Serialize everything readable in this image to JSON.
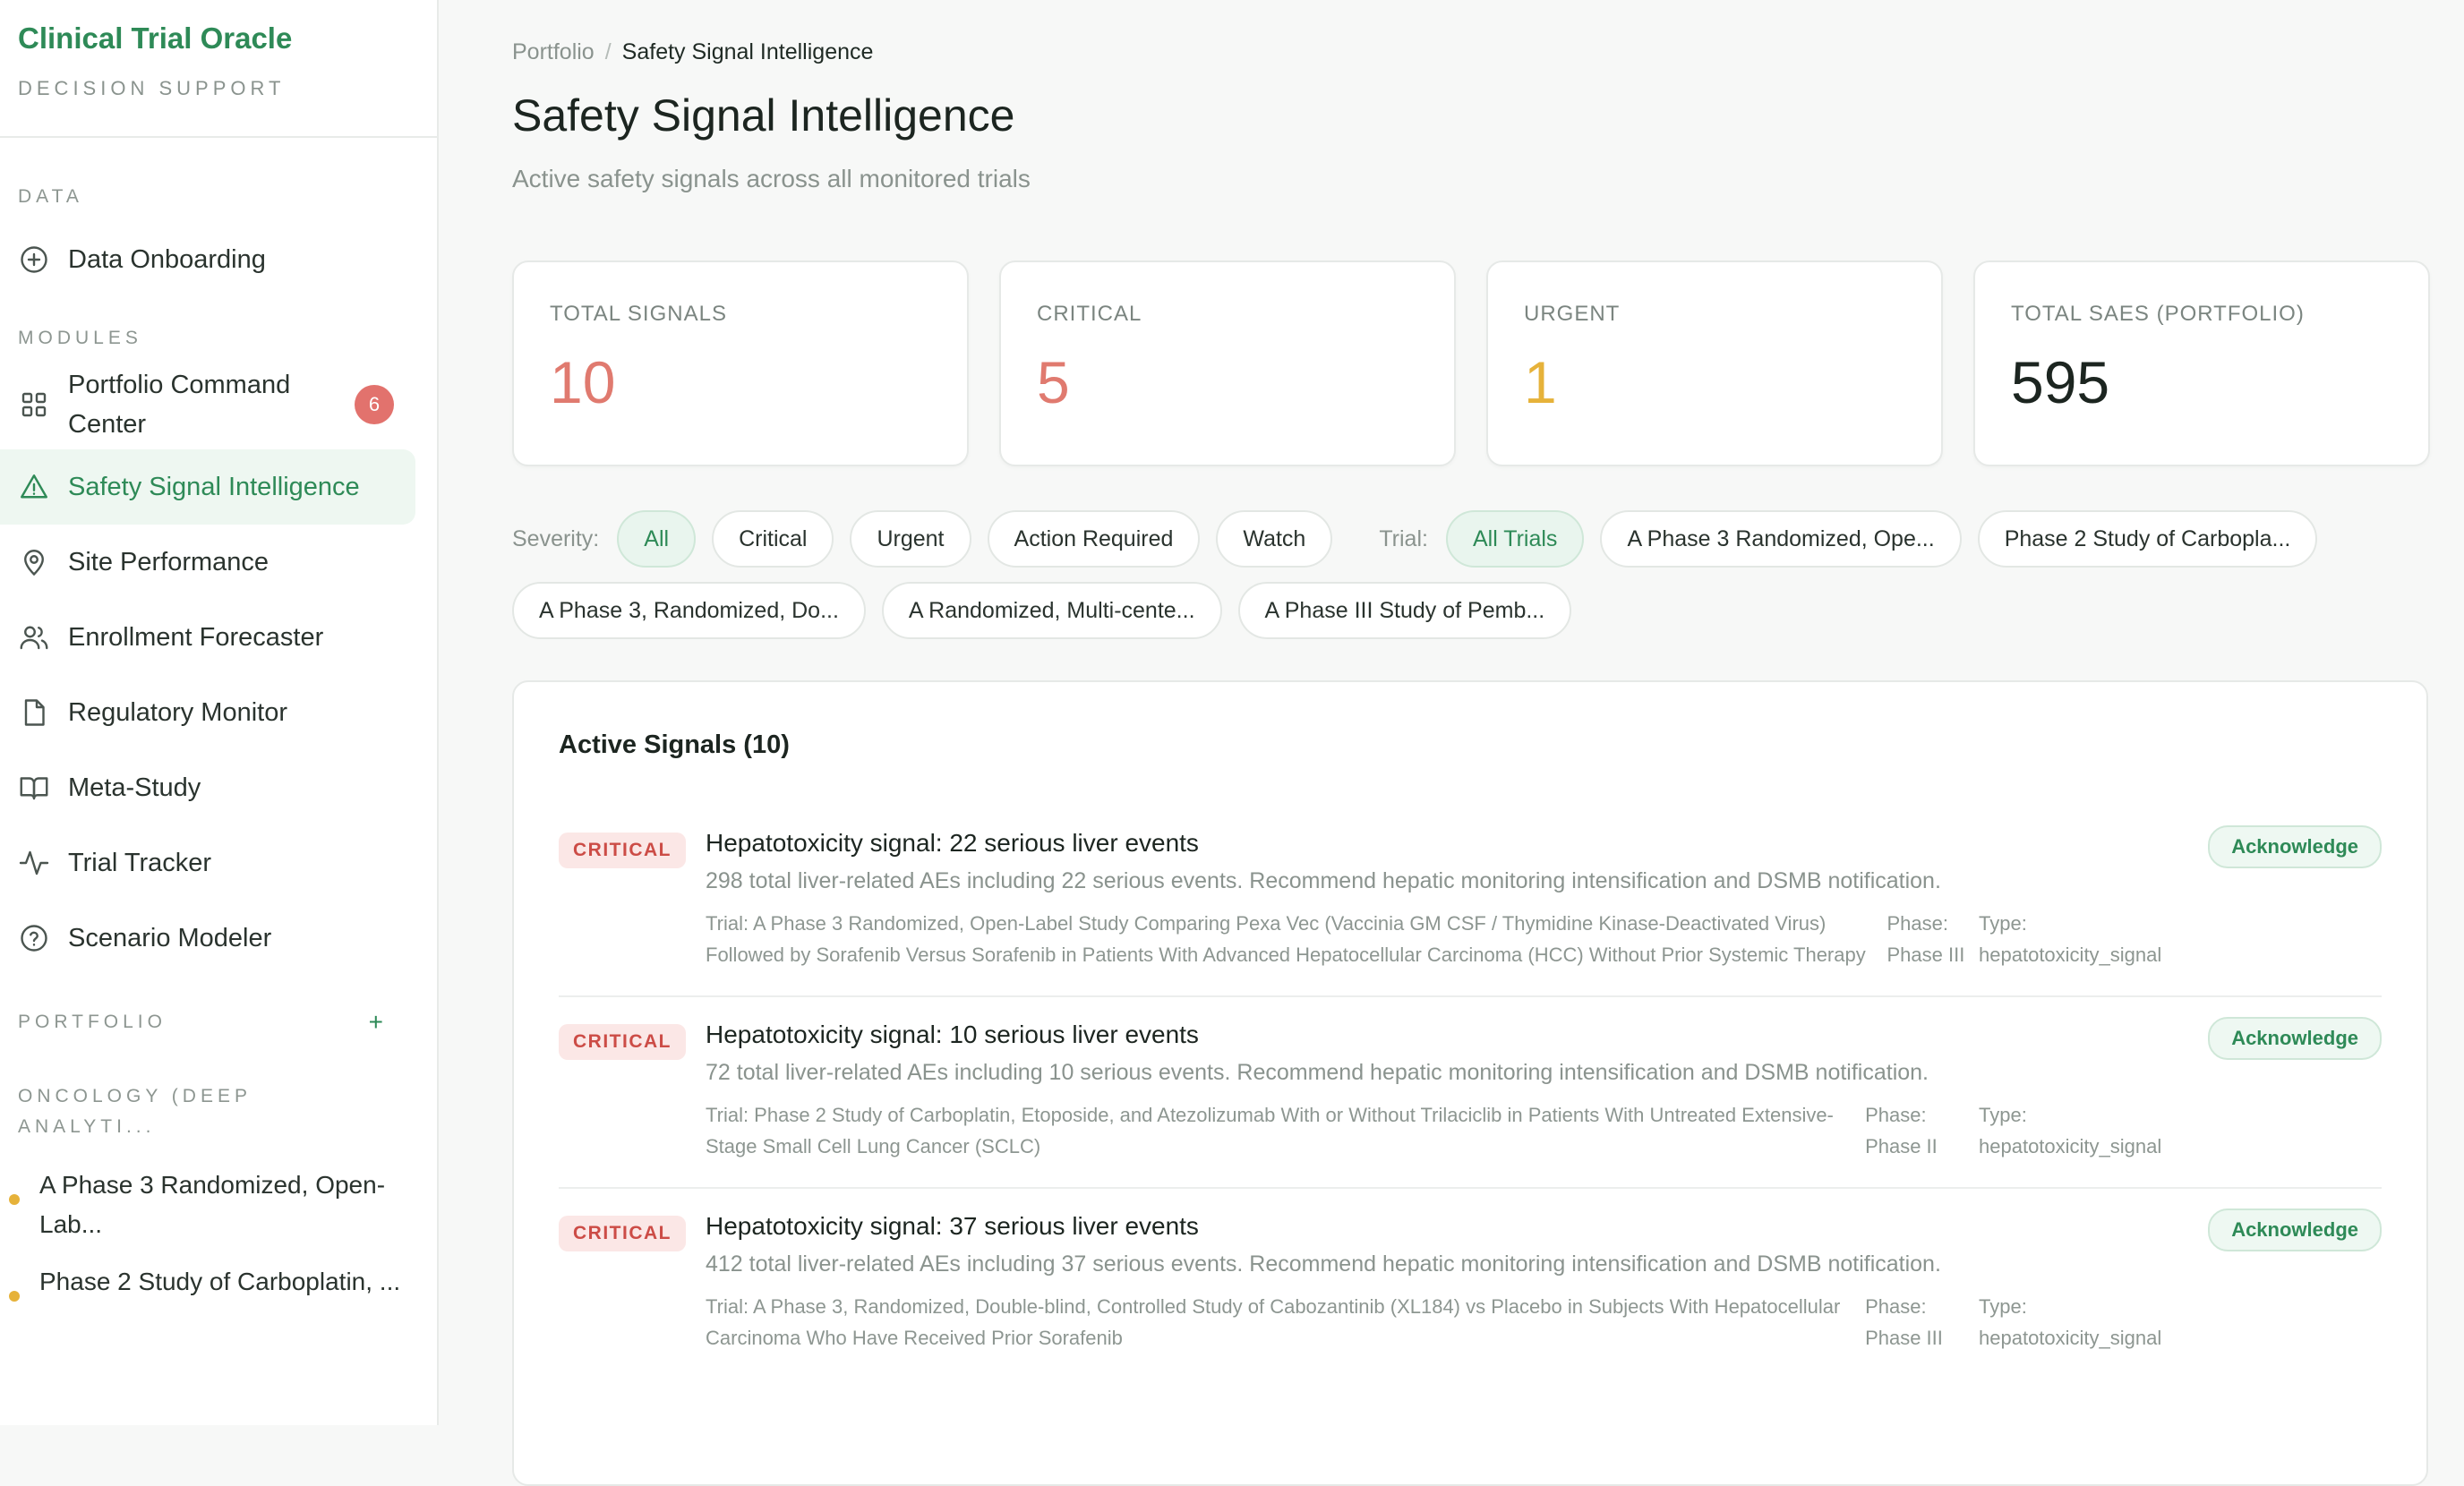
{
  "app": {
    "title": "Clinical Trial Oracle",
    "subtitle": "DECISION SUPPORT"
  },
  "sidebar": {
    "data_label": "DATA",
    "data_items": [
      {
        "label": "Data Onboarding",
        "icon": "plus-circle-icon"
      }
    ],
    "modules_label": "MODULES",
    "modules": [
      {
        "label": "Portfolio Command Center",
        "icon": "grid-icon",
        "badge": "6"
      },
      {
        "label": "Safety Signal Intelligence",
        "icon": "warning-triangle-icon",
        "active": true
      },
      {
        "label": "Site Performance",
        "icon": "map-pin-icon"
      },
      {
        "label": "Enrollment Forecaster",
        "icon": "users-icon"
      },
      {
        "label": "Regulatory Monitor",
        "icon": "file-icon"
      },
      {
        "label": "Meta-Study",
        "icon": "book-icon"
      },
      {
        "label": "Trial Tracker",
        "icon": "activity-icon"
      },
      {
        "label": "Scenario Modeler",
        "icon": "help-circle-icon"
      }
    ],
    "portfolio_label": "PORTFOLIO",
    "portfolio_add": "+",
    "group_label": "ONCOLOGY (DEEP ANALYTI...",
    "portfolio_items": [
      {
        "label": "A Phase 3 Randomized, Open-Lab..."
      },
      {
        "label": "Phase 2 Study of Carboplatin, ..."
      }
    ]
  },
  "breadcrumb": {
    "root": "Portfolio",
    "separator": "/",
    "current": "Safety Signal Intelligence"
  },
  "page": {
    "title": "Safety Signal Intelligence",
    "subtitle": "Active safety signals across all monitored trials"
  },
  "stats": [
    {
      "label": "TOTAL SIGNALS",
      "value": "10",
      "color": "#e07a6f"
    },
    {
      "label": "CRITICAL",
      "value": "5",
      "color": "#e07a6f"
    },
    {
      "label": "URGENT",
      "value": "1",
      "color": "#e6b23a"
    },
    {
      "label": "TOTAL SAES (PORTFOLIO)",
      "value": "595",
      "color": "#1c2520"
    }
  ],
  "filters": {
    "severity_label": "Severity:",
    "severity": [
      "All",
      "Critical",
      "Urgent",
      "Action Required",
      "Watch"
    ],
    "severity_selected": "All",
    "trial_label": "Trial:",
    "trials": [
      "All Trials",
      "A Phase 3 Randomized, Ope...",
      "Phase 2 Study of Carbopla...",
      "A Phase 3, Randomized, Do...",
      "A Randomized, Multi-cente...",
      "A Phase III Study of Pemb..."
    ],
    "trial_selected": "All Trials"
  },
  "signals": {
    "heading": "Active Signals (10)",
    "ack_label": "Acknowledge",
    "items": [
      {
        "severity": "CRITICAL",
        "title": "Hepatotoxicity signal: 22 serious liver events",
        "description": "298 total liver-related AEs including 22 serious events. Recommend hepatic monitoring intensification and DSMB notification.",
        "trial": "Trial: A Phase 3 Randomized, Open-Label Study Comparing Pexa Vec (Vaccinia GM CSF / Thymidine Kinase-Deactivated Virus) Followed by Sorafenib Versus Sorafenib in Patients With Advanced Hepatocellular Carcinoma (HCC) Without Prior Systemic Therapy",
        "phase": "Phase: Phase III",
        "type": "Type: hepatotoxicity_signal"
      },
      {
        "severity": "CRITICAL",
        "title": "Hepatotoxicity signal: 10 serious liver events",
        "description": "72 total liver-related AEs including 10 serious events. Recommend hepatic monitoring intensification and DSMB notification.",
        "trial": "Trial: Phase 2 Study of Carboplatin, Etoposide, and Atezolizumab With or Without Trilaciclib in Patients With Untreated Extensive-Stage Small Cell Lung Cancer (SCLC)",
        "phase": "Phase: Phase II",
        "type": "Type: hepatotoxicity_signal"
      },
      {
        "severity": "CRITICAL",
        "title": "Hepatotoxicity signal: 37 serious liver events",
        "description": "412 total liver-related AEs including 37 serious events. Recommend hepatic monitoring intensification and DSMB notification.",
        "trial": "Trial: A Phase 3, Randomized, Double-blind, Controlled Study of Cabozantinib (XL184) vs Placebo in Subjects With Hepatocellular Carcinoma Who Have Received Prior Sorafenib",
        "phase": "Phase: Phase III",
        "type": "Type: hepatotoxicity_signal"
      }
    ]
  },
  "colors": {
    "accent": "#2e8a57",
    "critical": "#cc4c46",
    "urgent": "#e6b23a",
    "badge": "#e2726d"
  }
}
